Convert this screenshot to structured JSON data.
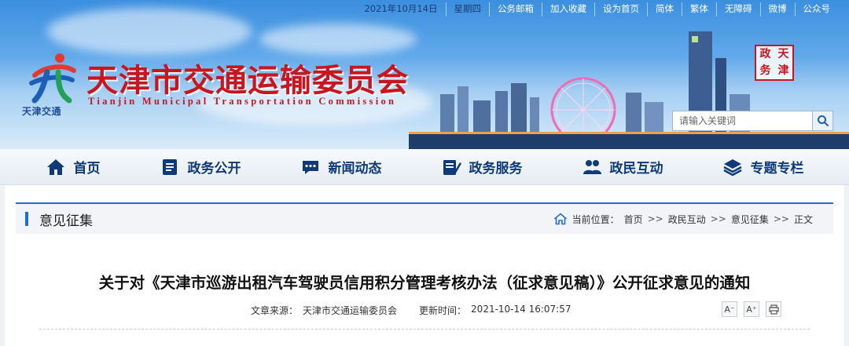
{
  "topbar": {
    "date": "2021年10月14日",
    "weekday": "星期四",
    "links": [
      "公务邮箱",
      "加入收藏",
      "设为首页",
      "简体",
      "繁体",
      "无障碍",
      "微博",
      "公众号"
    ]
  },
  "header": {
    "logo_text": "天津交通",
    "title": "天津市交通运输委员会",
    "subtitle": "Tianjin Municipal Transportation Commission",
    "seal_chars": [
      "天",
      "津",
      "政",
      "务"
    ],
    "search_placeholder": "请输入关键词"
  },
  "nav": {
    "items": [
      {
        "label": "首页",
        "icon": "home-icon"
      },
      {
        "label": "政务公开",
        "icon": "document-icon"
      },
      {
        "label": "新闻动态",
        "icon": "chat-icon"
      },
      {
        "label": "政务服务",
        "icon": "form-icon"
      },
      {
        "label": "政民互动",
        "icon": "people-icon"
      },
      {
        "label": "专题专栏",
        "icon": "layers-icon"
      }
    ]
  },
  "section": {
    "title": "意见征集",
    "breadcrumb_prefix": "当前位置：",
    "breadcrumb": [
      "首页",
      "政民互动",
      "意见征集",
      "正文"
    ],
    "breadcrumb_sep": ">>"
  },
  "article": {
    "title": "关于对《天津市巡游出租汽车驾驶员信用积分管理考核办法（征求意见稿）》公开征求意见的通知",
    "source_label": "文章来源：",
    "source": "天津市交通运输委员会",
    "time_label": "更新时间：",
    "time": "2021-10-14 16:07:57",
    "tools": [
      "A⁻",
      "A⁺"
    ]
  },
  "colors": {
    "brand_red": "#c7161e",
    "nav_blue": "#0e3a78",
    "accent_blue": "#1d6fd1"
  }
}
